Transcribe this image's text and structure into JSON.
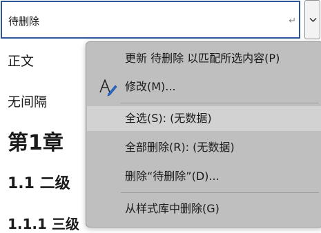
{
  "style_box": {
    "value": "待删除",
    "para_mark_icon": "paragraph-return-icon"
  },
  "dropdown_icon": "chevron-down-icon",
  "gallery": {
    "items": [
      {
        "label": "正文"
      },
      {
        "label": "无间隔"
      },
      {
        "label": "第1章"
      },
      {
        "label": "1.1 二级"
      },
      {
        "label": "1.1.1 三级"
      }
    ]
  },
  "menu": {
    "items": [
      {
        "label": "更新 待删除 以匹配所选内容(P)"
      },
      {
        "label": "修改(M)...",
        "icon": "modify-style-icon"
      },
      {
        "label": "全选(S): (无数据)"
      },
      {
        "label": "全部删除(R): (无数据)"
      },
      {
        "label": "删除“待删除”(D)..."
      },
      {
        "label": "从样式库中删除(G)"
      }
    ]
  }
}
